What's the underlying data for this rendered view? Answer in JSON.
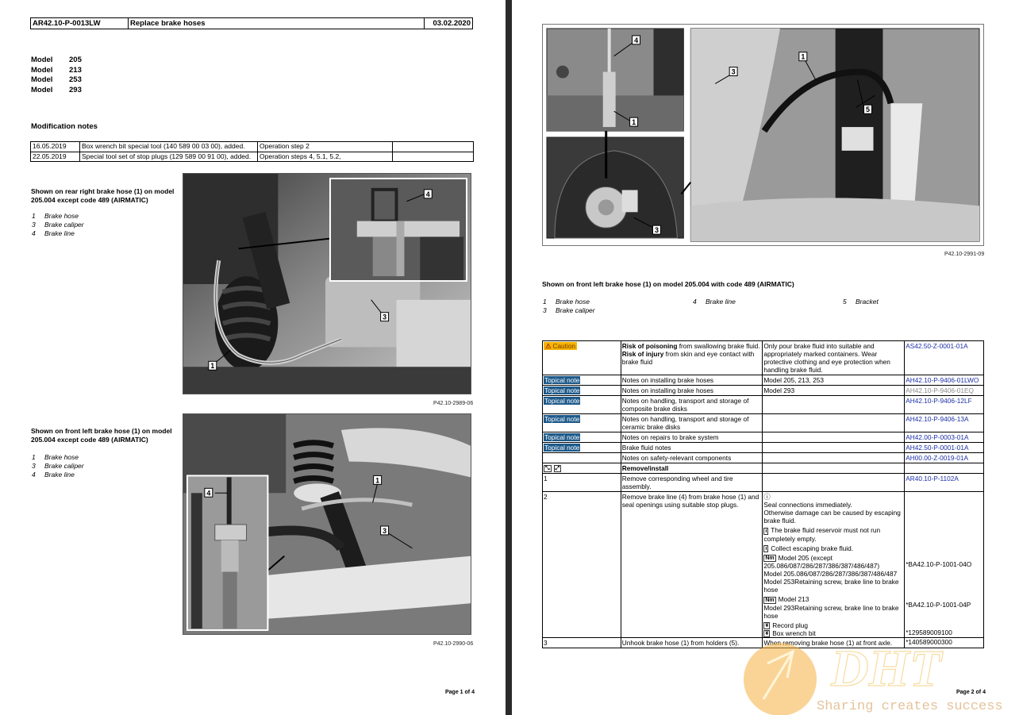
{
  "page1": {
    "header": {
      "doc_id": "AR42.10-P-0013LW",
      "title": "Replace brake hoses",
      "date": "03.02.2020"
    },
    "models": [
      {
        "label": "Model",
        "value": "205"
      },
      {
        "label": "Model",
        "value": "213"
      },
      {
        "label": "Model",
        "value": "253"
      },
      {
        "label": "Model",
        "value": "293"
      }
    ],
    "modification_notes": {
      "heading": "Modification notes",
      "rows": [
        {
          "date": "16.05.2019",
          "description": "Box wrench bit special tool (140 589 00 03 00), added.",
          "step": "Operation step 2",
          "extra": ""
        },
        {
          "date": "22.05.2019",
          "description": "Special tool set of stop plugs (129 589 00 91 00), added.",
          "step": "Operation steps 4, 5.1, 5.2,",
          "extra": ""
        }
      ]
    },
    "figure1": {
      "caption": "Shown on rear right brake hose (1) on model 205.004 except code 489 (AIRMATIC)",
      "legend": [
        {
          "n": "1",
          "label": "Brake hose"
        },
        {
          "n": "3",
          "label": "Brake caliper"
        },
        {
          "n": "4",
          "label": "Brake line"
        }
      ],
      "callouts": [
        "1",
        "3",
        "4"
      ],
      "ref": "P42.10-2989-06"
    },
    "figure2": {
      "caption": "Shown on front left brake hose (1) on model 205.004 except code 489 (AIRMATIC)",
      "legend": [
        {
          "n": "1",
          "label": "Brake hose"
        },
        {
          "n": "3",
          "label": "Brake caliper"
        },
        {
          "n": "4",
          "label": "Brake line"
        }
      ],
      "callouts": [
        "1",
        "3",
        "4"
      ],
      "ref": "P42.10-2990-06"
    },
    "page_number": "Page 1 of 4"
  },
  "page2": {
    "figure": {
      "callouts": [
        "4",
        "1",
        "3",
        "3",
        "1",
        "5"
      ],
      "ref": "P42.10-2991-09",
      "caption": "Shown on front left brake hose (1) on model 205.004 with code 489 (AIRMATIC)",
      "legend": [
        {
          "n": "1",
          "label": "Brake hose"
        },
        {
          "n": "4",
          "label": "Brake line"
        },
        {
          "n": "5",
          "label": "Bracket"
        },
        {
          "n": "3",
          "label": "Brake caliper"
        }
      ]
    },
    "table": {
      "caution": {
        "badge": "Caution",
        "risk_bold_1": "Risk of poisoning",
        "risk_text_1": " from swallowing brake fluid. ",
        "risk_bold_2": "Risk of injury",
        "risk_text_2": " from skin and eye contact with brake fluid",
        "measure": "Only pour brake fluid into suitable and appropriately marked containers. Wear protective clothing and eye protection when handling brake fluid.",
        "ref": "AS42.50-Z-0001-01A"
      },
      "notes": [
        {
          "badge": "Topical note",
          "text": "Notes on installing brake hoses",
          "applies": "Model 205, 213, 253",
          "ref": "AH42.10-P-9406-01LWO",
          "ref_gray": false
        },
        {
          "badge": "Topical note",
          "text": "Notes on installing brake hoses",
          "applies": "Model 293",
          "ref": "AH42.10-P-9406-01EQ",
          "ref_gray": true
        },
        {
          "badge": "Topical note",
          "text": "Notes on handling, transport and storage of composite brake disks",
          "applies": "",
          "ref": "AH42.10-P-9406-12LF",
          "ref_gray": false
        },
        {
          "badge": "Topical note",
          "text": "Notes on handling, transport and storage of ceramic brake disks",
          "applies": "",
          "ref": "AH42.10-P-9406-13A",
          "ref_gray": false
        },
        {
          "badge": "Topical note",
          "text": "Notes on repairs to brake system",
          "applies": "",
          "ref": "AH42.00-P-0003-01A",
          "ref_gray": false
        },
        {
          "badge": "Topical note",
          "text": "Brake fluid notes",
          "applies": "",
          "ref": "AH42.50-P-0001-01A",
          "ref_gray": false
        },
        {
          "badge": "",
          "text": "Notes on safety-relevant components",
          "applies": "",
          "ref": "AH00.00-Z-0019-01A",
          "ref_gray": false
        }
      ],
      "section": {
        "icons": [
          "remove-icon",
          "install-icon"
        ],
        "title": "Remove/install"
      },
      "step1": {
        "n": "1",
        "text": "Remove corresponding wheel and tire assembly.",
        "ref": "AR40.10-P-1102A"
      },
      "step2": {
        "n": "2",
        "text": "Remove brake line (4) from brake hose (1) and seal openings using suitable stop plugs.",
        "note_warning": "Seal connections immediately.\nOtherwise damage can be caused by escaping brake fluid.",
        "info1": "The brake fluid reservoir must not run completely empty.",
        "info2": "Collect escaping brake fluid.",
        "torque1": {
          "icon": "Nm",
          "lines": [
            "Model 205 (except 205.086/087/286/287/386/387/486/487)",
            "Model 205.086/087/286/287/386/387/486/487",
            "Model 253Retaining screw, brake line to brake hose"
          ],
          "ref": "*BA42.10-P-1001-04O"
        },
        "torque2": {
          "icon": "Nm",
          "lines": [
            "Model 213",
            "Model 293Retaining screw, brake line to brake hose"
          ],
          "ref": "*BA42.10-P-1001-04P"
        },
        "tool1": {
          "label": "Record plug",
          "ref": "*129589009100"
        },
        "tool2": {
          "label": "Box wrench bit",
          "ref": "*140589000300"
        }
      },
      "step3": {
        "n": "3",
        "text": "Unhook brake hose (1) from holders (5).",
        "note": "When removing brake hose (1) at front axle."
      }
    },
    "page_number": "Page 2 of 4"
  },
  "watermark": {
    "brand": "DHT",
    "slogan": "Sharing creates success"
  }
}
